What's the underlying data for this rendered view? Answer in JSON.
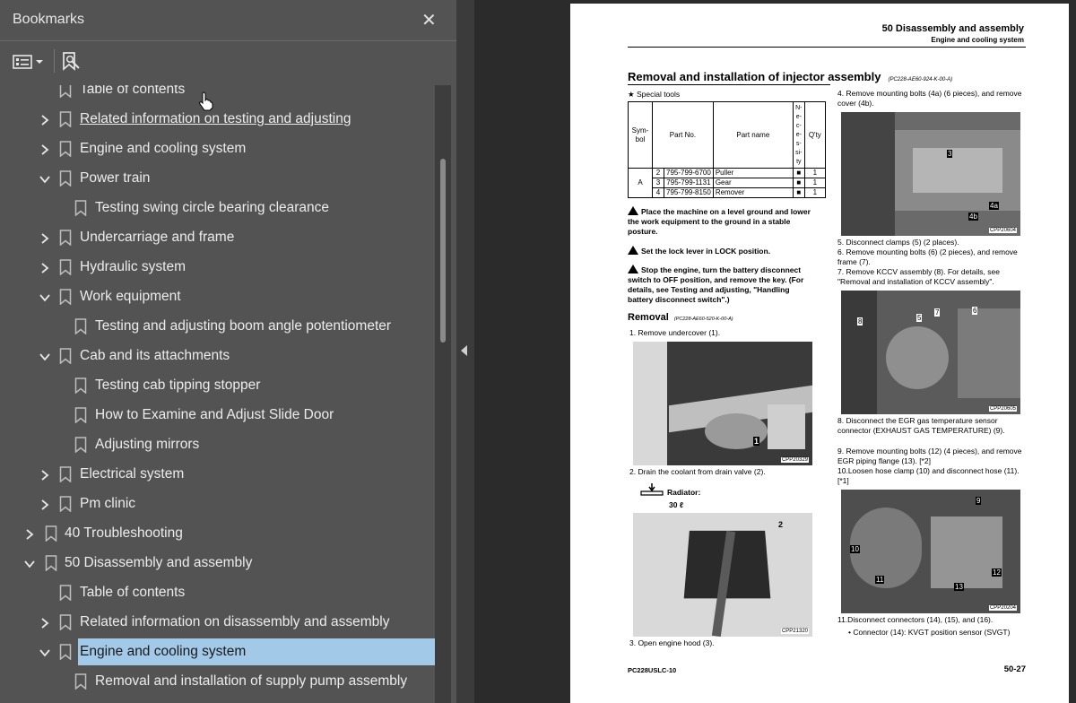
{
  "sidebar": {
    "title": "Bookmarks",
    "close_icon": "close-icon",
    "items": [
      {
        "label": "Table of contents",
        "level": 1,
        "expand": "none",
        "underline": false
      },
      {
        "label": "Related information on testing and adjusting",
        "level": 1,
        "expand": "collapsed",
        "underline": true
      },
      {
        "label": "Engine and cooling system",
        "level": 1,
        "expand": "collapsed",
        "underline": false
      },
      {
        "label": "Power train",
        "level": 1,
        "expand": "expanded",
        "underline": false
      },
      {
        "label": "Testing swing circle bearing clearance",
        "level": 2,
        "expand": "none",
        "underline": false
      },
      {
        "label": "Undercarriage and frame",
        "level": 1,
        "expand": "collapsed",
        "underline": false
      },
      {
        "label": "Hydraulic system",
        "level": 1,
        "expand": "collapsed",
        "underline": false
      },
      {
        "label": "Work equipment",
        "level": 1,
        "expand": "expanded",
        "underline": false
      },
      {
        "label": "Testing and adjusting boom angle potentiometer",
        "level": 2,
        "expand": "none",
        "underline": false
      },
      {
        "label": "Cab and its attachments",
        "level": 1,
        "expand": "expanded",
        "underline": false
      },
      {
        "label": "Testing cab tipping stopper",
        "level": 2,
        "expand": "none",
        "underline": false
      },
      {
        "label": "How to Examine and Adjust Slide Door",
        "level": 2,
        "expand": "none",
        "underline": false
      },
      {
        "label": "Adjusting mirrors",
        "level": 2,
        "expand": "none",
        "underline": false
      },
      {
        "label": "Electrical system",
        "level": 1,
        "expand": "collapsed",
        "underline": false
      },
      {
        "label": "Pm clinic",
        "level": 1,
        "expand": "collapsed",
        "underline": false
      },
      {
        "label": "40 Troubleshooting",
        "level": 0,
        "expand": "collapsed",
        "underline": false
      },
      {
        "label": "50 Disassembly and assembly",
        "level": 0,
        "expand": "expanded",
        "underline": false
      },
      {
        "label": "Table of contents",
        "level": 1,
        "expand": "none",
        "underline": false
      },
      {
        "label": "Related information on disassembly and assembly",
        "level": 1,
        "expand": "collapsed",
        "underline": false
      },
      {
        "label": "Engine and cooling system",
        "level": 1,
        "expand": "expanded",
        "underline": false,
        "selected": true
      },
      {
        "label": "Removal and installation of supply pump assembly",
        "level": 2,
        "expand": "none",
        "underline": false
      }
    ]
  },
  "document": {
    "header_title": "50 Disassembly and assembly",
    "header_subtitle": "Engine and cooling system",
    "section_title": "Removal and installation of injector assembly",
    "section_code": "(PC228-AE60-924-K-00-A)",
    "special_tools": "★  Special tools",
    "tools_table": {
      "headers": [
        "Sym-bol",
        "Part No.",
        "Part name",
        "N-e-c-e-s-si-ty",
        "Q'ty"
      ],
      "symbol": "A",
      "rows": [
        {
          "no": "2",
          "part": "795-799-6700",
          "name": "Puller",
          "nec": "■",
          "qty": "1"
        },
        {
          "no": "3",
          "part": "795-799-1131",
          "name": "Gear",
          "nec": "■",
          "qty": "1"
        },
        {
          "no": "4",
          "part": "795-799-8150",
          "name": "Remover",
          "nec": "■",
          "qty": "1"
        }
      ]
    },
    "warnings": [
      "Place the machine on a level ground and lower the work equipment to the ground in a stable posture.",
      "Set the lock lever in LOCK position.",
      "Stop the engine, turn the battery disconnect switch to OFF position, and remove the key. (For details, see Testing and adjusting, \"Handling battery disconnect switch\".)"
    ],
    "removal_title": "Removal",
    "removal_code": "(PC228-AE60-520-K-00-A)",
    "steps_left": [
      "1.  Remove undercover (1).",
      "2.  Drain the coolant from drain valve (2).",
      "3.  Open engine hood (3)."
    ],
    "radiator_label": "Radiator:",
    "radiator_value": "30 ℓ",
    "photo_labels": [
      "CPP20329",
      "CPP21320",
      "CPP20604",
      "CPP20605",
      "CPP20204"
    ],
    "steps_right": [
      "4.  Remove mounting bolts (4a) (6 pieces), and remove cover (4b).",
      "5.  Disconnect clamps (5) (2 places).",
      "6.  Remove mounting bolts (6) (2 pieces), and remove frame (7).",
      "7.  Remove KCCV assembly (8). For details, see \"Removal and installation of KCCV assembly\".",
      "8.  Disconnect the EGR gas temperature sensor connector (EXHAUST GAS TEMPERATURE) (9).",
      "9.  Remove mounting bolts (12) (4 pieces), and remove EGR piping flange (13). [*2]",
      "10.Loosen hose clamp (10) and disconnect hose (11). [*1]",
      "11.Disconnect connectors (14), (15), and (16).",
      "•  Connector (14): KVGT position sensor (SVGT)"
    ],
    "footer_left": "PC228USLC-10",
    "footer_right": "50-27"
  }
}
